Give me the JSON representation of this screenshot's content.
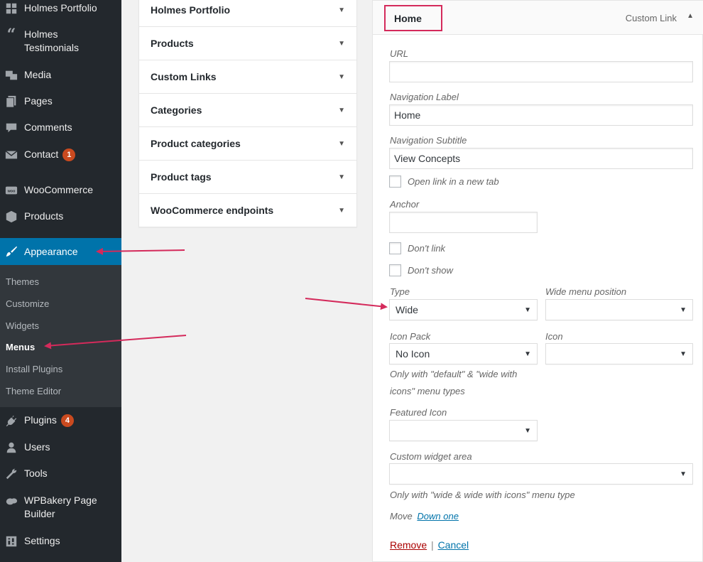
{
  "sidebar": {
    "items": [
      {
        "label": "Holmes Portfolio",
        "icon": "grid-icon"
      },
      {
        "label": "Holmes Testimonials",
        "icon": "quote-icon"
      },
      {
        "label": "Media",
        "icon": "media-icon"
      },
      {
        "label": "Pages",
        "icon": "pages-icon"
      },
      {
        "label": "Comments",
        "icon": "comments-icon"
      },
      {
        "label": "Contact",
        "icon": "mail-icon",
        "badge": "1"
      },
      {
        "label": "WooCommerce",
        "icon": "woo-icon"
      },
      {
        "label": "Products",
        "icon": "box-icon"
      }
    ],
    "appearance": {
      "label": "Appearance",
      "icon": "brush-icon"
    },
    "submenu": [
      "Themes",
      "Customize",
      "Widgets",
      "Menus",
      "Install Plugins",
      "Theme Editor"
    ],
    "lower_items": [
      {
        "label": "Plugins",
        "icon": "plug-icon",
        "badge": "4"
      },
      {
        "label": "Users",
        "icon": "users-icon"
      },
      {
        "label": "Tools",
        "icon": "wrench-icon"
      },
      {
        "label": "WPBakery Page Builder",
        "icon": "cloud-icon"
      },
      {
        "label": "Settings",
        "icon": "settings-icon"
      }
    ],
    "colors": {
      "bg": "#23282d",
      "active": "#0073aa",
      "submenu_bg": "#32373c",
      "badge": "#ca4a1f"
    }
  },
  "accordion": {
    "sections": [
      "Holmes Portfolio",
      "Products",
      "Custom Links",
      "Categories",
      "Product categories",
      "Product tags",
      "WooCommerce endpoints"
    ],
    "arrow": "▼"
  },
  "menu_item": {
    "title": "Home",
    "type": "Custom Link",
    "toggle": "▲",
    "url_label": "URL",
    "url_value": "",
    "nav_label_label": "Navigation Label",
    "nav_label_value": "Home",
    "nav_subtitle_label": "Navigation Subtitle",
    "nav_subtitle_value": "View Concepts",
    "open_new_tab_label": "Open link in a new tab",
    "anchor_label": "Anchor",
    "anchor_value": "",
    "dont_link_label": "Don't link",
    "dont_show_label": "Don't show",
    "type_label": "Type",
    "type_value": "Wide",
    "wide_menu_position_label": "Wide menu position",
    "wide_menu_position_value": "",
    "icon_pack_label": "Icon Pack",
    "icon_pack_value": "No Icon",
    "icon_label": "Icon",
    "icon_value": "",
    "icon_note_line1": "Only with \"default\" & \"wide with",
    "icon_note_line2": "icons\" menu types",
    "featured_icon_label": "Featured Icon",
    "featured_icon_value": "",
    "custom_widget_area_label": "Custom widget area",
    "custom_widget_area_value": "",
    "widget_note": "Only with \"wide & wide with icons\" menu type",
    "move_label": "Move",
    "move_link": "Down one",
    "remove_link": "Remove",
    "separator": "|",
    "cancel_link": "Cancel",
    "caret": "▼"
  },
  "annotation_color": "#d42a5b"
}
